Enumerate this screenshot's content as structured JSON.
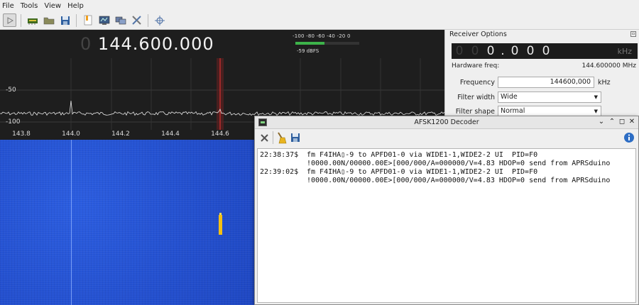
{
  "menu": [
    "File",
    "Tools",
    "View",
    "Help"
  ],
  "toolbar_icons": [
    "play-icon",
    "hardware-icon",
    "folder-icon",
    "save-icon",
    "bookmark-icon",
    "screen-icon",
    "network-icon",
    "tools-icon",
    "crosshair-icon"
  ],
  "spectrum": {
    "freq_prefix": "0",
    "freq_main": "144.600.000",
    "meter_scale": "-100 -80 -60 -40 -20 0",
    "meter_level_fraction": 0.45,
    "meter_dbfs": "-59 dBFS",
    "y_labels": [
      "-50",
      "-100"
    ],
    "x_labels": [
      "143.8",
      "144.0",
      "144.2",
      "144.4",
      "144.6"
    ]
  },
  "receiver": {
    "title": "Receiver Options",
    "lcd_digits": [
      "0",
      "0",
      "0",
      ".",
      "0",
      "0",
      "0"
    ],
    "lcd_unit": "kHz",
    "hw_freq_label": "Hardware freq:",
    "hw_freq_value": "144.600000 MHz",
    "frequency_label": "Frequency",
    "frequency_value": "144600,000",
    "frequency_unit": "kHz",
    "filter_width_label": "Filter width",
    "filter_width_value": "Wide",
    "filter_shape_label": "Filter shape",
    "filter_shape_value": "Normal"
  },
  "decoder": {
    "title": "AFSK1200 Decoder",
    "min_button": "⌄",
    "max_button": "⌃",
    "restore_button": "◻",
    "close_button": "✕",
    "messages": [
      {
        "time": "22:38:37$",
        "line1": "fm F4IHA▯-9 to APFD01-0 via WIDE1-1,WIDE2-2 UI  PID=F0",
        "line2": "!0000.00N/00000.00E>[000/000/A=000000/V=4.83 HDOP=0 send from APRSduino"
      },
      {
        "time": "22:39:02$",
        "line1": "fm F4IHA▯-9 to APFD01-0 via WIDE1-1,WIDE2-2 UI  PID=F0",
        "line2": "!0000.00N/00000.00E>[000/000/A=000000/V=4.83 HDOP=0 send from APRSduino"
      }
    ]
  }
}
